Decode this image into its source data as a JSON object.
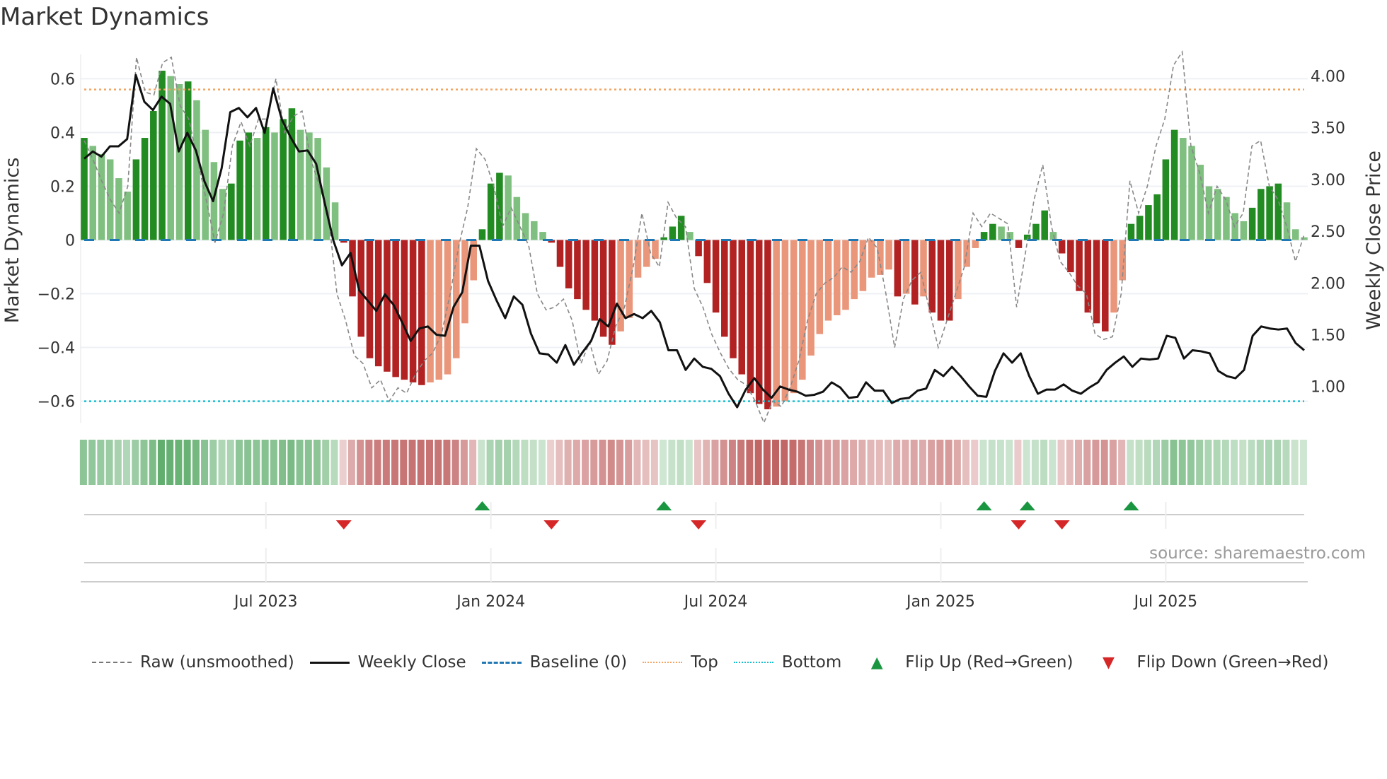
{
  "title": "Market Dynamics",
  "source": "source: sharemaestro.com",
  "chart_data": {
    "type": "bar",
    "title": "Market Dynamics",
    "ylabel": "Market Dynamics",
    "y2label": "Weekly Close Price",
    "ylim": [
      -0.68,
      0.68
    ],
    "y2lim": [
      0.65,
      4.18
    ],
    "yticks": [
      {
        "v": 0.6,
        "label": "0.6"
      },
      {
        "v": 0.4,
        "label": "0.4"
      },
      {
        "v": 0.2,
        "label": "0.2"
      },
      {
        "v": 0,
        "label": "0"
      },
      {
        "v": -0.2,
        "label": "−0.2"
      },
      {
        "v": -0.4,
        "label": "−0.4"
      },
      {
        "v": -0.6,
        "label": "−0.6"
      }
    ],
    "y2ticks": [
      {
        "v": 4.0,
        "label": "4.00"
      },
      {
        "v": 3.5,
        "label": "3.50"
      },
      {
        "v": 3.0,
        "label": "3.00"
      },
      {
        "v": 2.5,
        "label": "2.50"
      },
      {
        "v": 2.0,
        "label": "2.00"
      },
      {
        "v": 1.5,
        "label": "1.50"
      },
      {
        "v": 1.0,
        "label": "1.00"
      }
    ],
    "xticks": [
      {
        "week": 21,
        "label": "Jul 2023"
      },
      {
        "week": 47,
        "label": "Jan 2024"
      },
      {
        "week": 73,
        "label": "Jul 2024"
      },
      {
        "week": 99,
        "label": "Jan 2025"
      },
      {
        "week": 125,
        "label": "Jul 2025"
      }
    ],
    "top": 0.56,
    "bottom": -0.6,
    "baseline": 0,
    "values": [
      0.38,
      0.35,
      0.32,
      0.3,
      0.23,
      0.18,
      0.3,
      0.38,
      0.48,
      0.63,
      0.61,
      0.58,
      0.59,
      0.52,
      0.41,
      0.29,
      0.19,
      0.21,
      0.37,
      0.4,
      0.38,
      0.42,
      0.4,
      0.45,
      0.49,
      0.41,
      0.4,
      0.38,
      0.27,
      0.14,
      -0.01,
      -0.21,
      -0.36,
      -0.44,
      -0.47,
      -0.49,
      -0.51,
      -0.52,
      -0.53,
      -0.54,
      -0.53,
      -0.52,
      -0.5,
      -0.44,
      -0.31,
      -0.15,
      0.04,
      0.21,
      0.25,
      0.24,
      0.16,
      0.1,
      0.07,
      0.03,
      -0.01,
      -0.1,
      -0.18,
      -0.22,
      -0.26,
      -0.3,
      -0.36,
      -0.39,
      -0.34,
      -0.29,
      -0.14,
      -0.1,
      -0.07,
      0.01,
      0.05,
      0.09,
      0.03,
      -0.06,
      -0.16,
      -0.27,
      -0.36,
      -0.44,
      -0.5,
      -0.57,
      -0.61,
      -0.63,
      -0.62,
      -0.6,
      -0.57,
      -0.52,
      -0.43,
      -0.35,
      -0.3,
      -0.28,
      -0.26,
      -0.22,
      -0.19,
      -0.14,
      -0.13,
      -0.11,
      -0.21,
      -0.2,
      -0.24,
      -0.21,
      -0.27,
      -0.3,
      -0.3,
      -0.22,
      -0.1,
      -0.03,
      0.03,
      0.06,
      0.05,
      0.03,
      -0.03,
      0.02,
      0.06,
      0.11,
      0.03,
      -0.05,
      -0.12,
      -0.19,
      -0.27,
      -0.31,
      -0.34,
      -0.27,
      -0.15,
      0.06,
      0.09,
      0.13,
      0.17,
      0.3,
      0.41,
      0.38,
      0.35,
      0.28,
      0.2,
      0.19,
      0.16,
      0.1,
      0.07,
      0.12,
      0.19,
      0.2,
      0.21,
      0.14,
      0.04,
      0.01
    ],
    "raw": [
      0.37,
      0.3,
      0.22,
      0.15,
      0.1,
      0.2,
      0.68,
      0.55,
      0.54,
      0.66,
      0.68,
      0.5,
      0.45,
      0.3,
      0.15,
      -0.01,
      0.1,
      0.35,
      0.44,
      0.35,
      0.45,
      0.45,
      0.6,
      0.4,
      0.46,
      0.48,
      0.3,
      0.2,
      0.1,
      -0.2,
      -0.3,
      -0.43,
      -0.46,
      -0.55,
      -0.52,
      -0.6,
      -0.55,
      -0.57,
      -0.5,
      -0.45,
      -0.42,
      -0.35,
      -0.2,
      -0.02,
      0.12,
      0.34,
      0.3,
      0.2,
      0.05,
      0.12,
      0.05,
      -0.02,
      -0.2,
      -0.26,
      -0.25,
      -0.22,
      -0.3,
      -0.46,
      -0.38,
      -0.5,
      -0.45,
      -0.32,
      -0.25,
      -0.1,
      0.1,
      -0.05,
      -0.1,
      0.14,
      0.08,
      0.05,
      -0.18,
      -0.25,
      -0.35,
      -0.42,
      -0.48,
      -0.52,
      -0.54,
      -0.6,
      -0.68,
      -0.6,
      -0.62,
      -0.55,
      -0.45,
      -0.3,
      -0.2,
      -0.16,
      -0.14,
      -0.1,
      -0.12,
      -0.08,
      0.01,
      -0.03,
      -0.2,
      -0.4,
      -0.22,
      -0.15,
      -0.12,
      -0.26,
      -0.4,
      -0.3,
      -0.2,
      -0.1,
      0.1,
      0.05,
      0.1,
      0.08,
      0.06,
      -0.25,
      -0.05,
      0.15,
      0.28,
      0.05,
      -0.08,
      -0.12,
      -0.17,
      -0.2,
      -0.35,
      -0.37,
      -0.36,
      -0.2,
      0.22,
      0.1,
      0.2,
      0.35,
      0.45,
      0.65,
      0.7,
      0.35,
      0.25,
      0.1,
      0.2,
      0.15,
      0.05,
      0.1,
      0.35,
      0.37,
      0.2,
      0.15,
      0.05,
      -0.08,
      0.02
    ],
    "weekly_close": [
      3.2,
      3.27,
      3.22,
      3.32,
      3.32,
      3.39,
      4.01,
      3.75,
      3.67,
      3.8,
      3.73,
      3.27,
      3.45,
      3.28,
      2.98,
      2.79,
      3.11,
      3.65,
      3.69,
      3.6,
      3.69,
      3.45,
      3.88,
      3.58,
      3.41,
      3.27,
      3.28,
      3.15,
      2.77,
      2.41,
      2.17,
      2.29,
      1.93,
      1.83,
      1.73,
      1.89,
      1.79,
      1.62,
      1.44,
      1.56,
      1.58,
      1.5,
      1.49,
      1.77,
      1.91,
      2.36,
      2.36,
      2.02,
      1.83,
      1.66,
      1.87,
      1.79,
      1.51,
      1.32,
      1.31,
      1.23,
      1.4,
      1.21,
      1.33,
      1.44,
      1.65,
      1.58,
      1.8,
      1.66,
      1.7,
      1.66,
      1.73,
      1.62,
      1.35,
      1.35,
      1.16,
      1.27,
      1.19,
      1.17,
      1.1,
      0.93,
      0.8,
      0.97,
      1.08,
      0.97,
      0.89,
      1.0,
      0.97,
      0.95,
      0.91,
      0.92,
      0.95,
      1.04,
      0.99,
      0.89,
      0.9,
      1.04,
      0.96,
      0.96,
      0.84,
      0.88,
      0.89,
      0.96,
      0.98,
      1.16,
      1.1,
      1.19,
      1.1,
      1.0,
      0.91,
      0.9,
      1.15,
      1.32,
      1.23,
      1.32,
      1.1,
      0.93,
      0.97,
      0.97,
      1.02,
      0.96,
      0.93,
      0.99,
      1.04,
      1.16,
      1.23,
      1.29,
      1.19,
      1.27,
      1.26,
      1.27,
      1.49,
      1.47,
      1.27,
      1.35,
      1.34,
      1.32,
      1.15,
      1.1,
      1.08,
      1.16,
      1.49,
      1.58,
      1.56,
      1.55,
      1.56,
      1.42,
      1.35
    ],
    "flip_up_weeks": [
      46,
      67,
      104,
      109,
      121
    ],
    "flip_down_weeks": [
      30,
      54,
      71,
      108,
      113
    ],
    "colors": {
      "green_strong": "#228b22",
      "green_weak": "#7fbf7f",
      "red_strong": "#b22222",
      "red_weak": "#e9967a",
      "top": "#f4a460",
      "bottom": "#17becf",
      "baseline": "#1f77b4",
      "flip_up": "#1a9641",
      "flip_down": "#d62728"
    }
  },
  "legend": [
    {
      "label": "Raw (unsmoothed)",
      "style": "raw"
    },
    {
      "label": "Weekly Close",
      "style": "close"
    },
    {
      "label": "Baseline (0)",
      "style": "baseline"
    },
    {
      "label": "Top",
      "style": "top"
    },
    {
      "label": "Bottom",
      "style": "bottom"
    },
    {
      "label": "Flip Up (Red→Green)",
      "style": "up"
    },
    {
      "label": "Flip Down (Green→Red)",
      "style": "down"
    }
  ]
}
